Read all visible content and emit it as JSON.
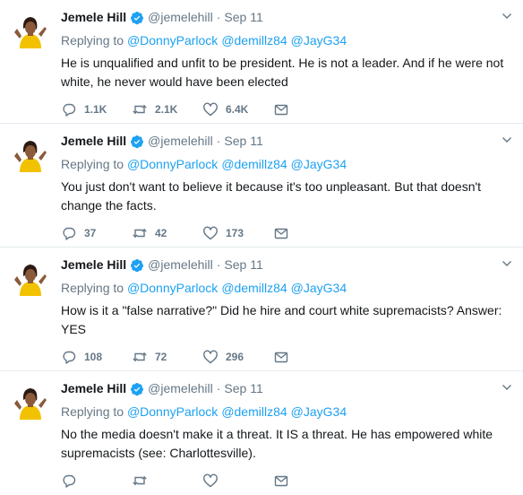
{
  "tweets": [
    {
      "name": "Jemele Hill",
      "handle": "@jemelehill",
      "separator": "·",
      "date": "Sep 11",
      "replying_prefix": "Replying to",
      "mentions": [
        "@DonnyParlock",
        "@demillz84",
        "@JayG34"
      ],
      "text": "He is unqualified and unfit to be president. He is not a leader. And if he were not white, he never would have been elected",
      "replies": "1.1K",
      "retweets": "2.1K",
      "likes": "6.4K"
    },
    {
      "name": "Jemele Hill",
      "handle": "@jemelehill",
      "separator": "·",
      "date": "Sep 11",
      "replying_prefix": "Replying to",
      "mentions": [
        "@DonnyParlock",
        "@demillz84",
        "@JayG34"
      ],
      "text": "You just don't want to believe it because it's too unpleasant. But that doesn't change the facts.",
      "replies": "37",
      "retweets": "42",
      "likes": "173"
    },
    {
      "name": "Jemele Hill",
      "handle": "@jemelehill",
      "separator": "·",
      "date": "Sep 11",
      "replying_prefix": "Replying to",
      "mentions": [
        "@DonnyParlock",
        "@demillz84",
        "@JayG34"
      ],
      "text": "How is it a \"false narrative?\" Did he hire and court white supremacists? Answer: YES",
      "replies": "108",
      "retweets": "72",
      "likes": "296"
    },
    {
      "name": "Jemele Hill",
      "handle": "@jemelehill",
      "separator": "·",
      "date": "Sep 11",
      "replying_prefix": "Replying to",
      "mentions": [
        "@DonnyParlock",
        "@demillz84",
        "@JayG34"
      ],
      "text": "No the media doesn't make it a threat. It IS a threat. He has empowered white supremacists (see: Charlottesville).",
      "replies": "",
      "retweets": "",
      "likes": ""
    }
  ],
  "colors": {
    "link": "#1da1f2",
    "muted": "#657786",
    "text": "#14171a",
    "divider": "#e6ecf0",
    "avatar_shirt": "#f2c200"
  },
  "icons": [
    "avatar",
    "verified-badge-icon",
    "chevron-down-icon",
    "reply-icon",
    "retweet-icon",
    "like-icon",
    "message-icon"
  ]
}
